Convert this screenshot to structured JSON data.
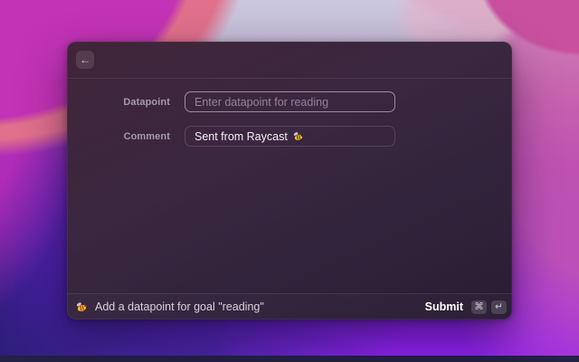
{
  "window": {
    "header": {
      "back_icon": "←"
    },
    "form": {
      "fields": [
        {
          "label": "Datapoint",
          "placeholder": "Enter datapoint for reading",
          "value": ""
        },
        {
          "label": "Comment",
          "value": "Sent from Raycast",
          "value_emoji": "🐝"
        }
      ]
    },
    "action_bar": {
      "app_icon": "beeminder-bee-icon",
      "status_text": "Add a datapoint for goal \"reading\"",
      "submit_label": "Submit",
      "shortcut_keys": [
        "⌘",
        "↵"
      ]
    }
  },
  "colors": {
    "window_bg_top": "#412539",
    "window_bg_bottom": "#281d33",
    "focused_field_border": "rgba(255,255,255,0.48)",
    "bee_yellow": "#f2c020",
    "wallpaper_magenta": "#c233b5",
    "wallpaper_violet": "#7d22da"
  }
}
